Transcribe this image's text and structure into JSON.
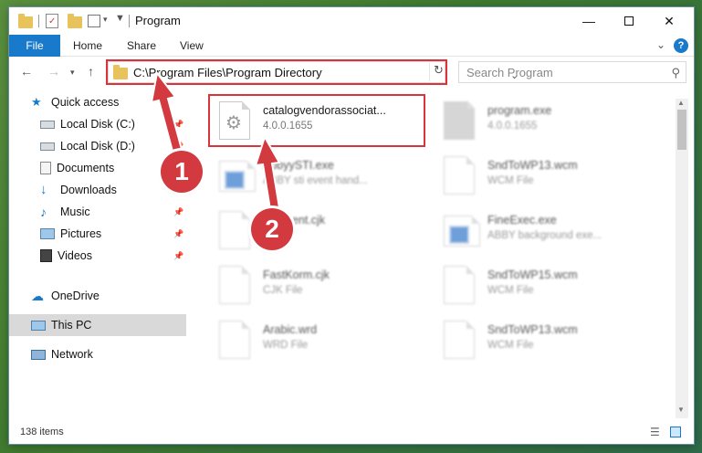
{
  "window": {
    "title": "Program",
    "quick_access_toolbar": [
      "folder-icon",
      "properties-icon",
      "new-folder-icon",
      "customize-icon"
    ]
  },
  "ribbon": {
    "tabs": [
      {
        "label": "File",
        "active": true
      },
      {
        "label": "Home"
      },
      {
        "label": "Share"
      },
      {
        "label": "View"
      }
    ]
  },
  "address_bar": {
    "path": "C:\\Program Files\\Program Directory"
  },
  "search": {
    "placeholder": "Search Program"
  },
  "sidebar": {
    "items": [
      {
        "label": "Quick access",
        "icon": "star-icon"
      },
      {
        "label": "Local Disk (C:)",
        "icon": "drive-icon",
        "pinned": true
      },
      {
        "label": "Local Disk (D:)",
        "icon": "drive-icon",
        "pinned": true
      },
      {
        "label": "Documents",
        "icon": "documents-icon",
        "pinned": true
      },
      {
        "label": "Downloads",
        "icon": "download-icon",
        "pinned": true
      },
      {
        "label": "Music",
        "icon": "music-icon",
        "pinned": true
      },
      {
        "label": "Pictures",
        "icon": "pictures-icon",
        "pinned": true
      },
      {
        "label": "Videos",
        "icon": "videos-icon",
        "pinned": true
      },
      {
        "label": "OneDrive",
        "icon": "cloud-icon"
      },
      {
        "label": "This PC",
        "icon": "computer-icon",
        "selected": true
      },
      {
        "label": "Network",
        "icon": "network-icon"
      }
    ]
  },
  "files": [
    {
      "name": "catalogvendorassociat...",
      "sub": "4.0.0.1655",
      "icon": "dll-gear-icon",
      "highlighted": true
    },
    {
      "name": "program.exe",
      "sub": "4.0.0.1655",
      "icon": "installer-icon"
    },
    {
      "name": "AbbyySTI.exe",
      "sub": "ABBY sti event hand...",
      "icon": "app-icon"
    },
    {
      "name": "SndToWP13.wcm",
      "sub": "WCM File",
      "icon": "file-icon"
    },
    {
      "name": "Ecoment.cjk",
      "sub": "",
      "icon": "file-icon"
    },
    {
      "name": "FineExec.exe",
      "sub": "ABBY background exe...",
      "icon": "app-icon"
    },
    {
      "name": "FastKorm.cjk",
      "sub": "CJK File",
      "icon": "file-icon"
    },
    {
      "name": "SndToWP15.wcm",
      "sub": "WCM File",
      "icon": "file-icon"
    },
    {
      "name": "Arabic.wrd",
      "sub": "WRD File",
      "icon": "file-icon"
    },
    {
      "name": "SndToWP13.wcm",
      "sub": "WCM File",
      "icon": "file-icon"
    }
  ],
  "status": {
    "item_count": "138 items"
  },
  "annotations": {
    "badge_1": "1",
    "badge_2": "2",
    "color": "#d23a3f"
  }
}
